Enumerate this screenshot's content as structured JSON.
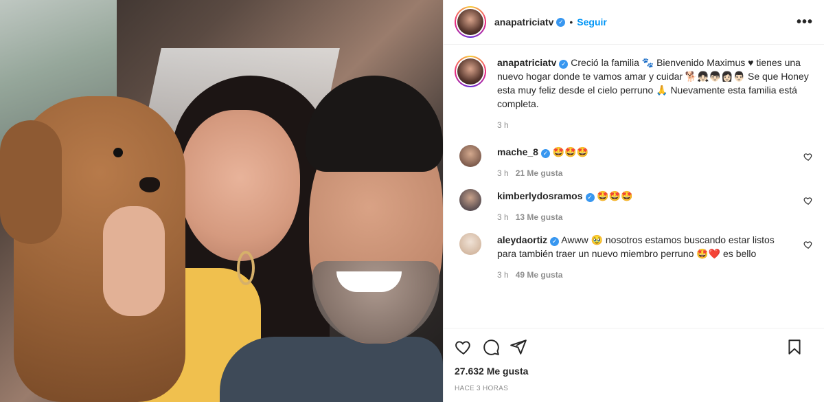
{
  "post": {
    "username": "anapatriciatv",
    "follow_label": "Seguir",
    "more_label": "•••",
    "likes_count": "27.632",
    "likes_label": "Me gusta",
    "timestamp": "HACE 3 HORAS"
  },
  "caption": {
    "username": "anapatriciatv",
    "text": "Creció la familia 🐾 Bienvenido Maximus ♥ tienes una nuevo hogar donde te vamos amar y cuidar 🐕👧🏻👦🏻👩🏻👨🏻 Se que Honey esta muy feliz desde el cielo perruno 🙏 Nuevamente esta familia está completa.",
    "time": "3 h"
  },
  "comments": [
    {
      "username": "mache_8",
      "text": "🤩🤩🤩",
      "time": "3 h",
      "likes": "21 Me gusta",
      "avatar_color": "#b48a74"
    },
    {
      "username": "kimberlydosramos",
      "text": "🤩🤩🤩",
      "time": "3 h",
      "likes": "13 Me gusta",
      "avatar_color": "#3b3a4a"
    },
    {
      "username": "aleydaortiz",
      "text": "Awww 🥹 nosotros estamos buscando estar listos para también traer un nuevo miembro perruno 🤩❤️ es bello",
      "time": "3 h",
      "likes": "49 Me gusta",
      "avatar_color": "#e6d3c4"
    }
  ],
  "colors": {
    "accent": "#0095f6",
    "verified": "#3897f0",
    "muted": "#8e8e8e"
  },
  "icons": [
    "heart-icon",
    "comment-icon",
    "share-icon",
    "bookmark-icon",
    "verified-icon",
    "more-icon"
  ]
}
